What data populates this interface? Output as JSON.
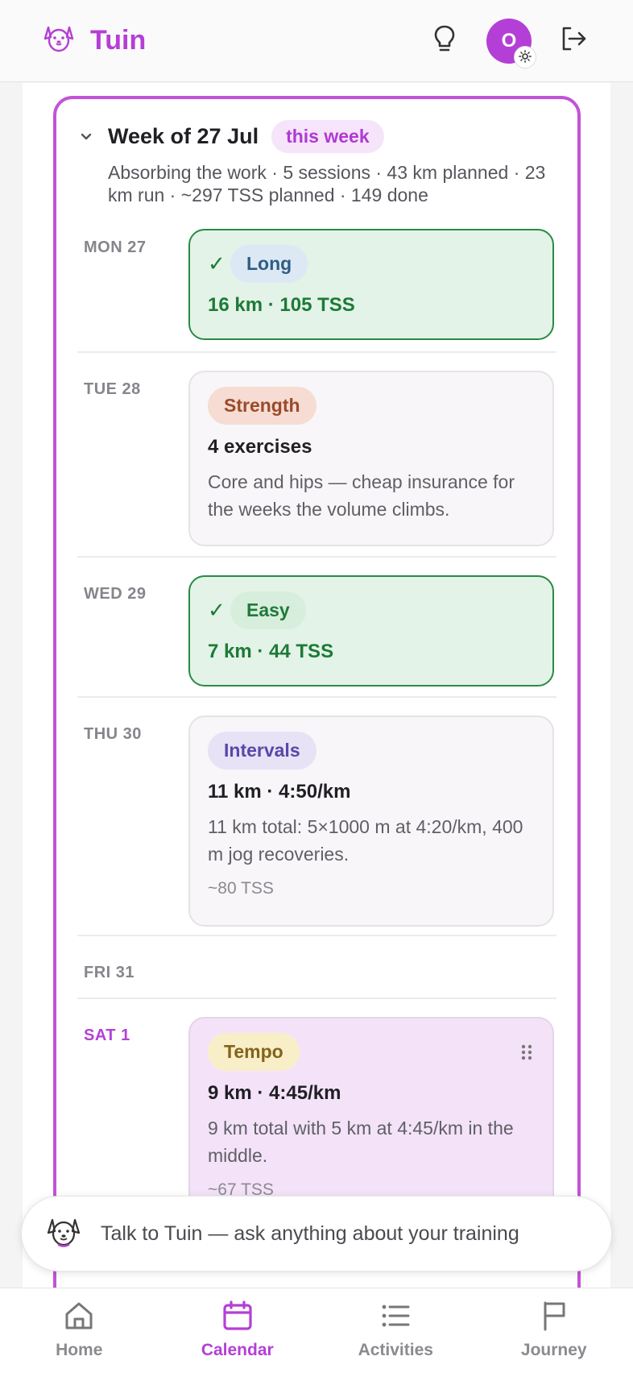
{
  "app": {
    "name": "Tuin"
  },
  "header": {
    "avatar_initial": "O"
  },
  "colors": {
    "brand": "#b43fd6",
    "done_green": "#1d7a37",
    "done_bg": "#e3f3e7"
  },
  "week": {
    "title": "Week of 27 Jul",
    "badge": "this week",
    "summary": "Absorbing the work · 5 sessions · 43 km planned · 23 km run · ~297 TSS planned · 149 done"
  },
  "days": {
    "mon": {
      "label": "MON 27",
      "session": {
        "done": true,
        "tag": "Long",
        "metric": "16 km · 105 TSS"
      }
    },
    "tue": {
      "label": "TUE 28",
      "session": {
        "tag": "Strength",
        "metric": "4 exercises",
        "desc": "Core and hips — cheap insurance for the weeks the volume climbs."
      }
    },
    "wed": {
      "label": "WED 29",
      "session": {
        "done": true,
        "tag": "Easy",
        "metric": "7 km · 44 TSS"
      }
    },
    "thu": {
      "label": "THU 30",
      "session": {
        "tag": "Intervals",
        "metric": "11 km · 4:50/km",
        "desc": "11 km total: 5×1000 m at 4:20/km, 400 m jog recoveries.",
        "tss": "~80 TSS"
      }
    },
    "fri": {
      "label": "FRI 31"
    },
    "sat": {
      "label": "SAT 1",
      "session": {
        "tag": "Tempo",
        "metric": "9 km · 4:45/km",
        "desc": "9 km total with 5 km at 4:45/km in the middle.",
        "tss": "~67 TSS"
      }
    }
  },
  "chat": {
    "prompt": "Talk to Tuin — ask anything about your training"
  },
  "nav": {
    "items": [
      {
        "label": "Home",
        "icon": "home-icon"
      },
      {
        "label": "Calendar",
        "icon": "calendar-icon",
        "active": true
      },
      {
        "label": "Activities",
        "icon": "list-icon"
      },
      {
        "label": "Journey",
        "icon": "flag-icon"
      }
    ]
  }
}
